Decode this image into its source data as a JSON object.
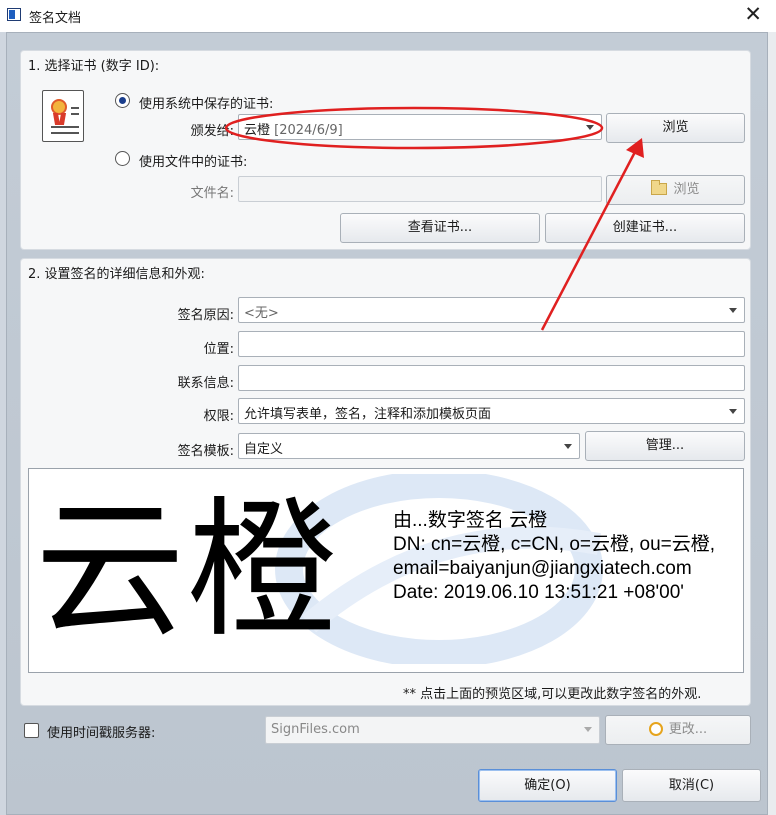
{
  "window": {
    "title": "签名文档",
    "close_glyph": "✕"
  },
  "section1": {
    "title": "1. 选择证书 (数字 ID):",
    "stored_radio_label": "使用系统中保存的证书:",
    "issued_to_label": "颁发给:",
    "issued_to_value": "云橙",
    "issued_to_date": "[2024/6/9]",
    "browse1_label": "浏览",
    "file_radio_label": "使用文件中的证书:",
    "filename_label": "文件名:",
    "filename_value": "",
    "browse2_label": "浏览",
    "view_cert_label": "查看证书...",
    "create_cert_label": "创建证书..."
  },
  "section2": {
    "title": "2. 设置签名的详细信息和外观:",
    "reason_label": "签名原因:",
    "reason_value": "<无>",
    "location_label": "位置:",
    "location_value": "",
    "contact_label": "联系信息:",
    "contact_value": "",
    "permission_label": "权限:",
    "permission_value": "允许填写表单，签名，注释和添加模板页面",
    "template_label": "签名模板:",
    "template_value": "自定义",
    "manage_label": "管理..."
  },
  "preview": {
    "big_name": "云橙",
    "line1": "由...数字签名 云橙",
    "line2": "DN: cn=云橙, c=CN, o=云橙, ou=云橙,",
    "line3": "email=baiyanjun@jiangxiatech.com",
    "line4": "Date: 2019.06.10 13:51:21 +08'00'"
  },
  "note": "** 点击上面的预览区域,可以更改此数字签名的外观.",
  "timestamp": {
    "label": "使用时间戳服务器:",
    "server_value": "SignFiles.com",
    "change_label": "更改..."
  },
  "footer": {
    "ok_label": "确定(O)",
    "cancel_label": "取消(C)"
  },
  "colors": {
    "dialog_bg": "#c3ccd6",
    "panel_bg": "#f6f7f8",
    "annotation_red": "#e02020",
    "radio_dot": "#1a3e8c"
  },
  "icons": [
    "certificate-icon",
    "folder-icon",
    "clock-icon",
    "close-icon"
  ]
}
